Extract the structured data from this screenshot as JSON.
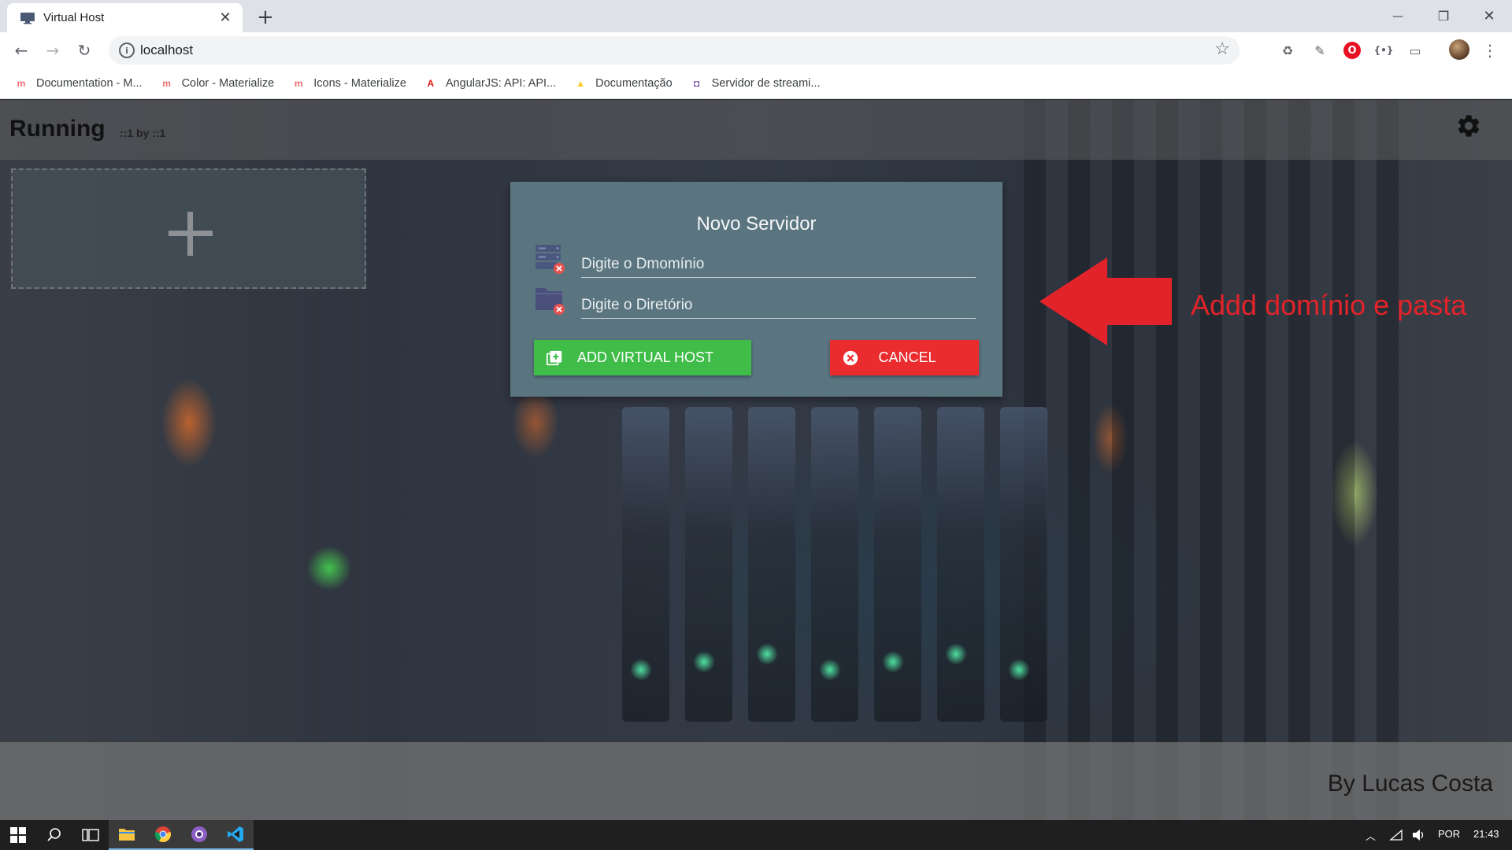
{
  "browser": {
    "tab_title": "Virtual Host",
    "close_glyph": "✕",
    "new_tab_glyph": "+",
    "url": "localhost",
    "info_glyph": "i",
    "star_glyph": "☆",
    "kebab_glyph": "⋮",
    "nav": {
      "back": "←",
      "forward": "→",
      "reload": "↻"
    },
    "window": {
      "minimize": "—",
      "maximize": "❐",
      "close": "✕"
    },
    "extensions": [
      "recycle-icon",
      "eyedropper-icon",
      "opera-icon",
      "json-icon",
      "cast-icon"
    ],
    "bookmarks": [
      {
        "label": "Documentation - M...",
        "icon": "materialize-icon",
        "color": "#ee6e73"
      },
      {
        "label": "Color - Materialize",
        "icon": "materialize-icon",
        "color": "#ee6e73"
      },
      {
        "label": "Icons - Materialize",
        "icon": "materialize-icon",
        "color": "#ee6e73"
      },
      {
        "label": "AngularJS: API: API...",
        "icon": "angular-icon",
        "color": "#dd1b16"
      },
      {
        "label": "Documentação",
        "icon": "firebase-icon",
        "color": "#ffca28"
      },
      {
        "label": "Servidor de streami...",
        "icon": "twitch-icon",
        "color": "#6441a5"
      }
    ]
  },
  "app": {
    "title": "Running",
    "subtitle": "::1 by ::1",
    "footer": "By Lucas Costa"
  },
  "modal": {
    "title": "Novo Servidor",
    "domain_placeholder": "Digite o Dmomínio",
    "domain_value": "",
    "directory_placeholder": "Digite o Diretório",
    "directory_value": "",
    "add_label": "ADD VIRTUAL HOST",
    "cancel_label": "CANCEL",
    "add_color": "#3fbd48",
    "cancel_color": "#ea2c2f"
  },
  "annotation": {
    "text": "Addd domínio e pasta",
    "color": "#e3232a"
  },
  "taskbar": {
    "apps": [
      "windows-start-icon",
      "search-icon",
      "task-view-icon",
      "file-explorer-icon",
      "chrome-icon",
      "obs-icon",
      "vscode-icon"
    ],
    "language": "POR",
    "time": "21:43"
  }
}
